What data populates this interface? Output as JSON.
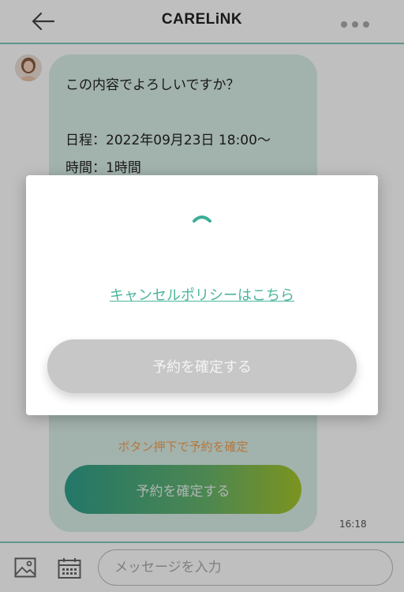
{
  "header": {
    "title": "CARELiNK"
  },
  "chat": {
    "message": "この内容でよろしいですか？\n\n日程：2022年09月23日 18:00～\n時間：1時間",
    "hint": "ボタン押下で予約を確定",
    "confirm_label": "予約を確定する",
    "timestamp": "16:18"
  },
  "composer": {
    "placeholder": "メッセージを入力",
    "value": ""
  },
  "modal": {
    "policy_link": "キャンセルポリシーはこちら",
    "confirm_label": "予約を確定する"
  },
  "colors": {
    "accent": "#4bb59c",
    "bubble": "#d8eee6",
    "hint": "#f0a156"
  },
  "icons": {
    "back": "arrow-left-icon",
    "more": "more-dots-icon",
    "image": "image-icon",
    "calendar": "calendar-icon",
    "spinner": "loading-spinner-icon"
  }
}
